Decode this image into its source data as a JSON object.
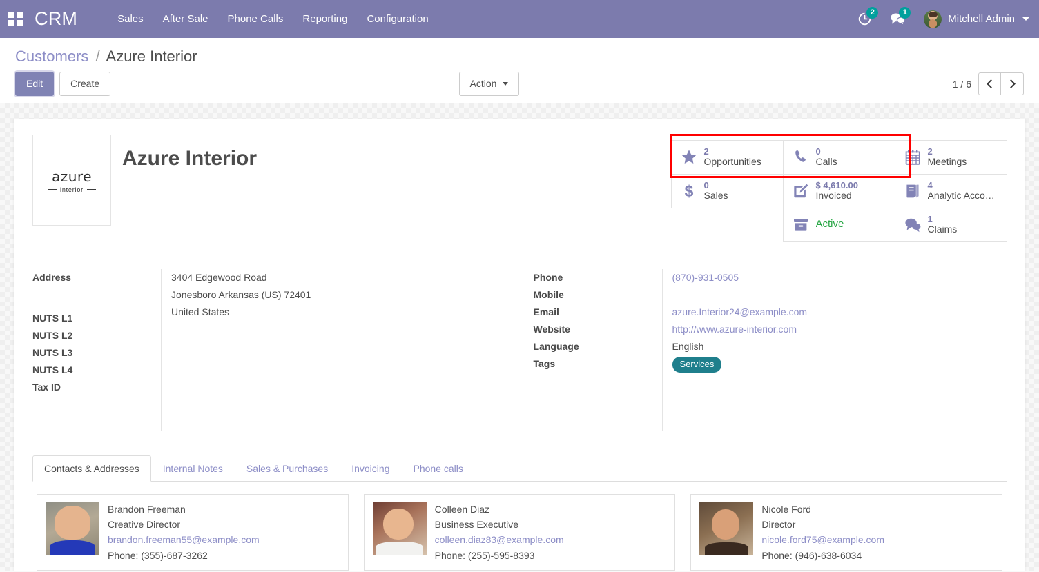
{
  "navbar": {
    "apps_icon": "apps-grid-icon",
    "brand": "CRM",
    "menu": [
      "Sales",
      "After Sale",
      "Phone Calls",
      "Reporting",
      "Configuration"
    ],
    "activity_icon": "clock-activity-icon",
    "activity_count": "2",
    "messages_icon": "chat-bubble-icon",
    "messages_count": "1",
    "user_name": "Mitchell Admin",
    "accent_color": "#7c7bad",
    "badge_color": "#00a09d"
  },
  "control_panel": {
    "breadcrumb_root": "Customers",
    "breadcrumb_sep": "/",
    "breadcrumb_current": "Azure Interior",
    "edit_label": "Edit",
    "create_label": "Create",
    "action_label": "Action",
    "pager": "1 / 6",
    "prev_icon": "chevron-left-icon",
    "next_icon": "chevron-right-icon"
  },
  "record": {
    "title": "Azure Interior",
    "logo_word": "azure",
    "logo_sub": "interior"
  },
  "stat_buttons": {
    "col1": [
      {
        "icon": "star-icon",
        "value": "2",
        "label": "Opportunities"
      },
      {
        "icon": "dollar-icon",
        "value": "0",
        "label": "Sales"
      }
    ],
    "col2": [
      {
        "icon": "phone-icon",
        "value": "0",
        "label": "Calls"
      },
      {
        "icon": "pencil-square-icon",
        "value": "$ 4,610.00",
        "label": "Invoiced"
      },
      {
        "icon": "archive-box-icon",
        "value": "",
        "label": "Active",
        "label_color": "#28a745"
      }
    ],
    "col3": [
      {
        "icon": "calendar-icon",
        "value": "2",
        "label": "Meetings"
      },
      {
        "icon": "book-icon",
        "value": "4",
        "label": "Analytic Acco…"
      },
      {
        "icon": "comments-icon",
        "value": "1",
        "label": "Claims"
      }
    ],
    "highlight_color": "#ff0000"
  },
  "fields": {
    "left": {
      "labels": [
        "Address",
        "NUTS L1",
        "NUTS L2",
        "NUTS L3",
        "NUTS L4",
        "Tax ID"
      ],
      "address_lines": [
        "3404 Edgewood Road",
        "Jonesboro  Arkansas (US)  72401",
        "United States"
      ]
    },
    "right": {
      "labels": [
        "Phone",
        "Mobile",
        "Email",
        "Website",
        "Language",
        "Tags"
      ],
      "phone": "(870)-931-0505",
      "mobile": "",
      "email": "azure.Interior24@example.com",
      "website": "http://www.azure-interior.com",
      "language": "English",
      "tag": "Services"
    }
  },
  "notebook": {
    "tabs": [
      "Contacts & Addresses",
      "Internal Notes",
      "Sales & Purchases",
      "Invoicing",
      "Phone calls"
    ],
    "active_tab": "Contacts & Addresses",
    "contacts": [
      {
        "name": "Brandon Freeman",
        "function": "Creative Director",
        "email": "brandon.freeman55@example.com",
        "phone": "Phone: (355)-687-3262",
        "avatar": "avatar-brandon-freeman"
      },
      {
        "name": "Colleen Diaz",
        "function": "Business Executive",
        "email": "colleen.diaz83@example.com",
        "phone": "Phone: (255)-595-8393",
        "avatar": "avatar-colleen-diaz"
      },
      {
        "name": "Nicole Ford",
        "function": "Director",
        "email": "nicole.ford75@example.com",
        "phone": "Phone: (946)-638-6034",
        "avatar": "avatar-nicole-ford"
      }
    ]
  }
}
